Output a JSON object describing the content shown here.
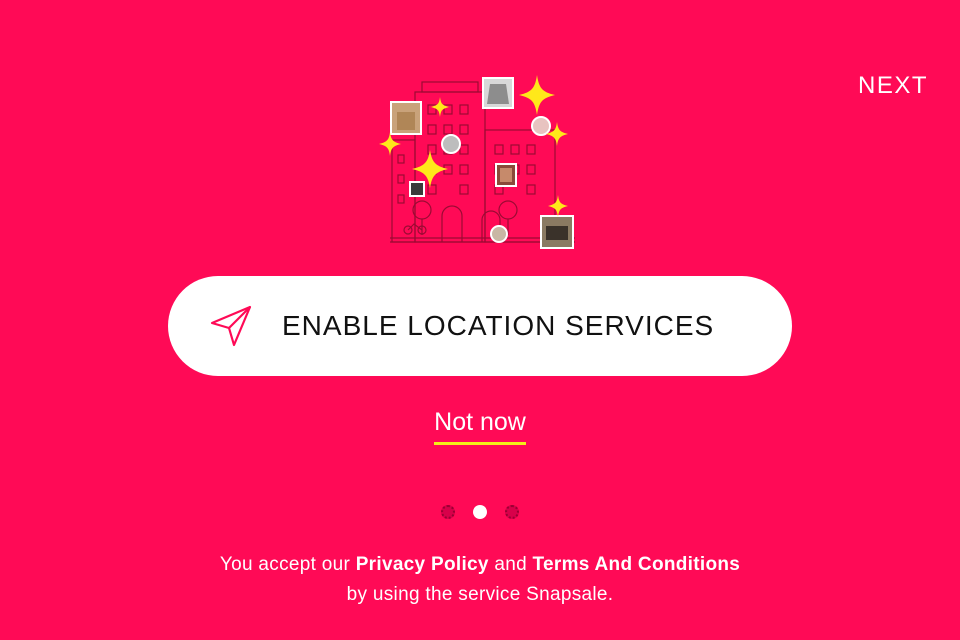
{
  "header": {
    "next_label": "NEXT"
  },
  "illustration": {
    "icon": "city-map-sparkles-illustration"
  },
  "cta": {
    "icon": "location-arrow-icon",
    "label": "ENABLE LOCATION SERVICES"
  },
  "secondary": {
    "not_now_label": "Not now"
  },
  "pager": {
    "total": 3,
    "active_index": 1
  },
  "legal": {
    "prefix": "You accept our ",
    "privacy_link": "Privacy Policy",
    "and": " and ",
    "terms_link": "Terms And Conditions",
    "line2": "by using the service Snapsale."
  },
  "colors": {
    "background": "#FF0A56",
    "accent_underline": "#F4EE19",
    "button_bg": "#FFFFFF",
    "sparkle": "#FFE81A"
  }
}
